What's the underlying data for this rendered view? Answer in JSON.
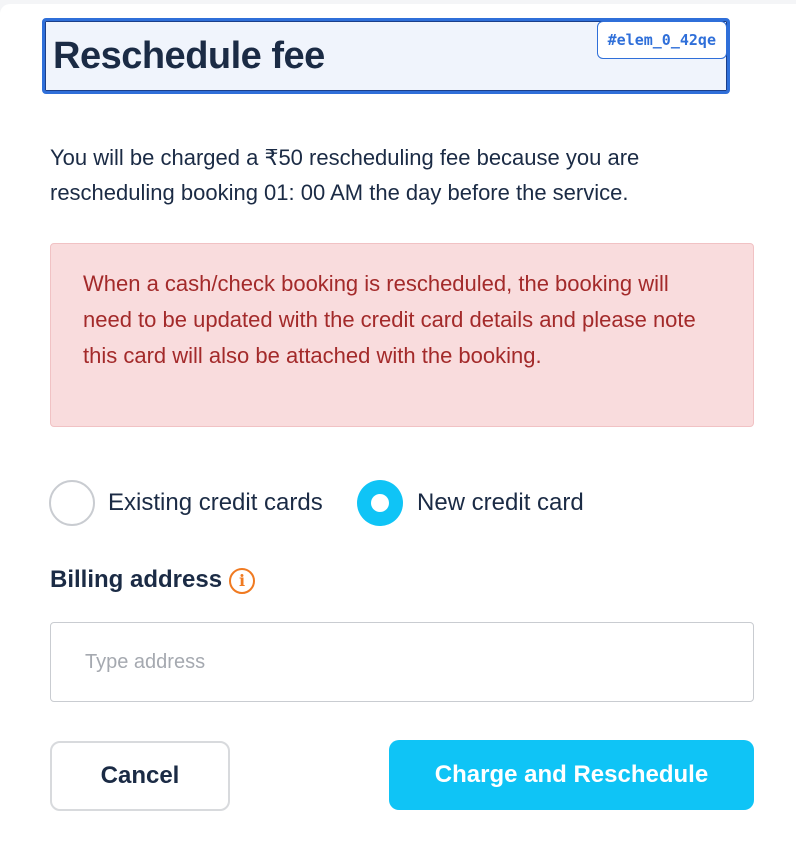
{
  "dialog": {
    "title": "Reschedule fee",
    "element_tag": "#elem_0_42qe",
    "description": "You will be charged a ₹50 rescheduling fee because you are rescheduling booking 01: 00 AM the day before the service.",
    "alert": "When a cash/check booking is rescheduled, the booking will need to be updated with the credit card details and please note this card will also be attached with the booking."
  },
  "payment_options": {
    "existing_label": "Existing credit cards",
    "new_label": "New credit card",
    "selected": "New credit card"
  },
  "billing": {
    "label": "Billing address",
    "info_icon": "info-icon",
    "info_glyph": "i",
    "placeholder": "Type address",
    "value": ""
  },
  "buttons": {
    "cancel": "Cancel",
    "submit": "Charge and Reschedule"
  },
  "colors": {
    "accent": "#0fc4f6",
    "alert_text": "#a32a2a",
    "alert_bg": "#f9dcdd",
    "info_icon": "#f07a21"
  }
}
